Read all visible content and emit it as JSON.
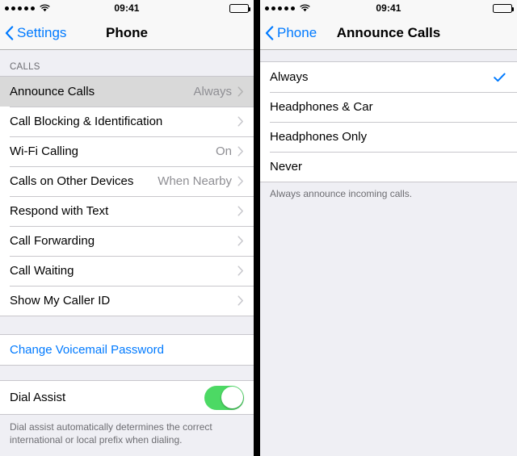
{
  "status_bar": {
    "signal_dots": 5,
    "wifi_icon": "wifi-icon",
    "time": "09:41",
    "battery_icon": "battery-full-icon"
  },
  "left_screen": {
    "nav": {
      "back_label": "Settings",
      "title": "Phone"
    },
    "section_calls": {
      "header": "CALLS",
      "rows": [
        {
          "label": "Announce Calls",
          "value": "Always",
          "selected": true
        },
        {
          "label": "Call Blocking & Identification",
          "value": "",
          "selected": false
        },
        {
          "label": "Wi-Fi Calling",
          "value": "On",
          "selected": false
        },
        {
          "label": "Calls on Other Devices",
          "value": "When Nearby",
          "selected": false
        },
        {
          "label": "Respond with Text",
          "value": "",
          "selected": false
        },
        {
          "label": "Call Forwarding",
          "value": "",
          "selected": false
        },
        {
          "label": "Call Waiting",
          "value": "",
          "selected": false
        },
        {
          "label": "Show My Caller ID",
          "value": "",
          "selected": false
        }
      ]
    },
    "section_voicemail": {
      "link_label": "Change Voicemail Password"
    },
    "section_dial_assist": {
      "label": "Dial Assist",
      "toggle_on": true,
      "footnote": "Dial assist automatically determines the correct international or local prefix when dialing."
    }
  },
  "right_screen": {
    "nav": {
      "back_label": "Phone",
      "title": "Announce Calls"
    },
    "options": [
      {
        "label": "Always",
        "checked": true
      },
      {
        "label": "Headphones & Car",
        "checked": false
      },
      {
        "label": "Headphones Only",
        "checked": false
      },
      {
        "label": "Never",
        "checked": false
      }
    ],
    "footnote": "Always announce incoming calls."
  },
  "colors": {
    "accent_blue": "#007AFF",
    "toggle_green": "#4CD964",
    "group_bg": "#EFEFF4",
    "selected_row": "#D9D9D9"
  }
}
